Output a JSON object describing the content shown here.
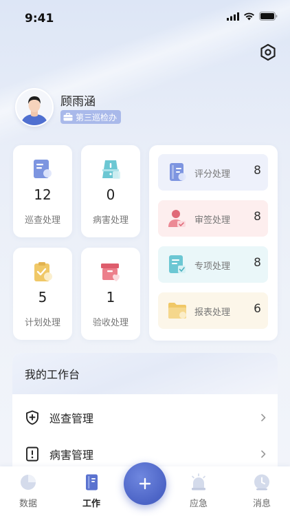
{
  "status_bar": {
    "time": "9:41"
  },
  "profile": {
    "name": "顾雨涵",
    "tag": "第三巡检办"
  },
  "stats": [
    {
      "value": "12",
      "label": "巡查处理",
      "icon": "doc-search-icon"
    },
    {
      "value": "0",
      "label": "病害处理",
      "icon": "bridge-alert-icon"
    },
    {
      "value": "5",
      "label": "计划处理",
      "icon": "clipboard-check-icon"
    },
    {
      "value": "1",
      "label": "验收处理",
      "icon": "box-heart-icon"
    }
  ],
  "processing": [
    {
      "label": "评分处理",
      "value": "8",
      "icon": "notebook-icon",
      "bg": "#eef1fb"
    },
    {
      "label": "审签处理",
      "value": "8",
      "icon": "user-sign-icon",
      "bg": "#fdeeee"
    },
    {
      "label": "专项处理",
      "value": "8",
      "icon": "doc-check-icon",
      "bg": "#eaf7f9"
    },
    {
      "label": "报表处理",
      "value": "6",
      "icon": "folder-icon",
      "bg": "#fcf6e9"
    }
  ],
  "workspace": {
    "title": "我的工作台",
    "items": [
      {
        "label": "巡查管理",
        "icon": "shield-plus-icon"
      },
      {
        "label": "病害管理",
        "icon": "alert-doc-icon"
      }
    ]
  },
  "nav": {
    "items": [
      {
        "label": "数据",
        "icon": "pie-chart-icon"
      },
      {
        "label": "工作",
        "icon": "work-book-icon",
        "active": true
      },
      {
        "label": "应急",
        "icon": "alarm-icon"
      },
      {
        "label": "消息",
        "icon": "message-clock-icon"
      }
    ],
    "fab_icon": "plus-icon"
  },
  "colors": {
    "accent": "#4c64c6",
    "tag_bg": "#a9b9ea"
  }
}
